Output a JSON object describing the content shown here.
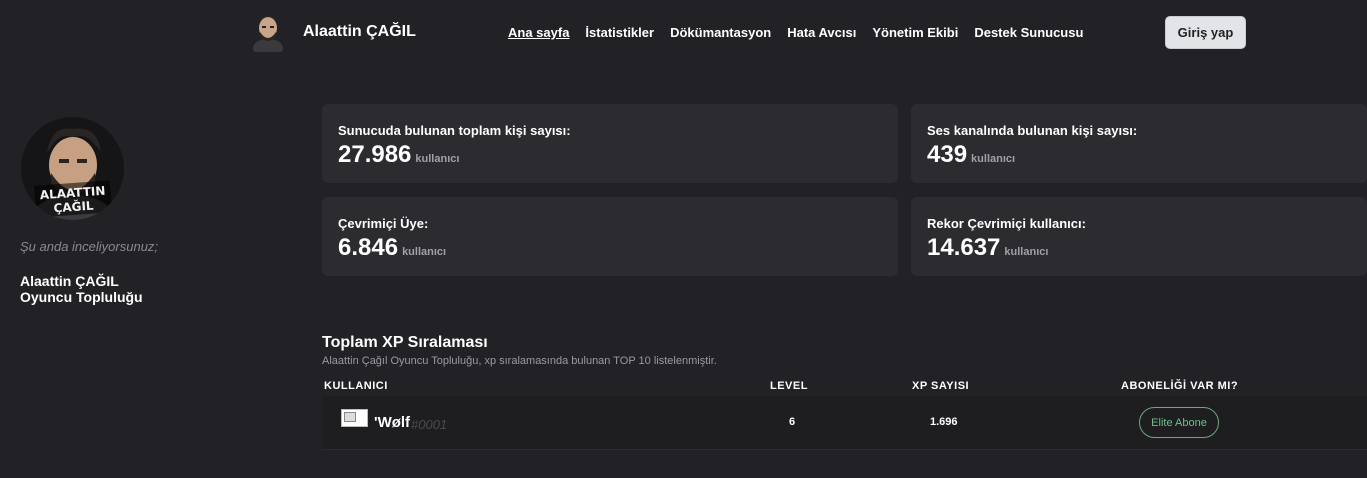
{
  "header": {
    "brand_title": "Alaattin ÇAĞIL",
    "nav": [
      {
        "label": "Ana sayfa",
        "active": true
      },
      {
        "label": "İstatistikler"
      },
      {
        "label": "Dökümantasyon"
      },
      {
        "label": "Hata Avcısı"
      },
      {
        "label": "Yönetim Ekibi"
      },
      {
        "label": "Destek Sunucusu"
      }
    ],
    "login_label": "Giriş yap"
  },
  "sidebar": {
    "avatar_text_1": "ALAATTIN",
    "avatar_text_2": "ÇAĞIL",
    "viewing_label": "Şu anda inceliyorsunuz;",
    "name_line1": "Alaattin ÇAĞIL",
    "name_line2": "Oyuncu Topluluğu"
  },
  "stats": [
    {
      "label": "Sunucuda bulunan toplam kişi sayısı:",
      "value": "27.986",
      "unit": "kullanıcı"
    },
    {
      "label": "Ses kanalında bulunan kişi sayısı:",
      "value": "439",
      "unit": "kullanıcı"
    },
    {
      "label": "Çevrimiçi Üye:",
      "value": "6.846",
      "unit": "kullanıcı"
    },
    {
      "label": "Rekor Çevrimiçi kullanıcı:",
      "value": "14.637",
      "unit": "kullanıcı"
    }
  ],
  "leaderboard": {
    "title": "Toplam XP Sıralaması",
    "subtitle": "Alaattin Çağıl Oyuncu Topluluğu, xp sıralamasında bulunan TOP 10 listelenmiştir.",
    "columns": [
      "KULLANICI",
      "LEVEL",
      "XP SAYISI",
      "ABONELİĞİ VAR MI?"
    ],
    "rows": [
      {
        "user": "'Wølf",
        "tag": "#0001",
        "level": "6",
        "xp": "1.696",
        "subscription": "Elite Abone"
      }
    ]
  },
  "colors": {
    "background": "#222226",
    "card": "#2b2b30",
    "badge": "#6fbf8a"
  }
}
